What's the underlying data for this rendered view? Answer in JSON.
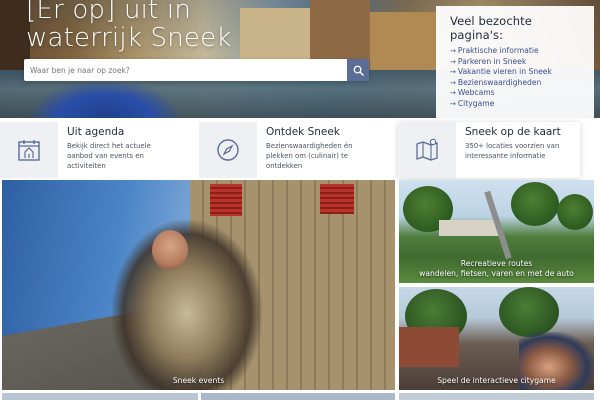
{
  "hero": {
    "title_line1": "[Er op] uit in",
    "title_line2": "waterrijk Sneek",
    "search_placeholder": "Waar ben je naar op zoek?",
    "search_icon": "search-icon"
  },
  "popular": {
    "heading": "Veel bezochte pagina's:",
    "links": [
      "Praktische informatie",
      "Parkeren in Sneek",
      "Vakantie vieren in Sneek",
      "Bezienswaardigheden",
      "Webcams",
      "Citygame"
    ],
    "link_color": "#3b4f8f"
  },
  "features": [
    {
      "title": "Uit agenda",
      "desc": "Bekijk direct het actuele aanbod van events en activiteiten",
      "icon": "calendar-icon"
    },
    {
      "title": "Ontdek Sneek",
      "desc": "Bezienswaardigheden én plekken om (culinair) te ontdekken",
      "icon": "compass-icon"
    },
    {
      "title": "Sneek op de kaart",
      "desc": "350+ locaties voorzien van interessante informatie",
      "icon": "map-icon"
    }
  ],
  "tiles": {
    "big_caption": "Sneek events",
    "r1_caption_line1": "Recreatieve routes",
    "r1_caption_line2": "wandelen, fietsen, varen en met de auto",
    "r2_caption": "Speel de interactieve citygame"
  },
  "colors": {
    "accent": "#5b6d96",
    "icon_bg": "#eef0f4",
    "text_dark": "#1f2b3c"
  }
}
